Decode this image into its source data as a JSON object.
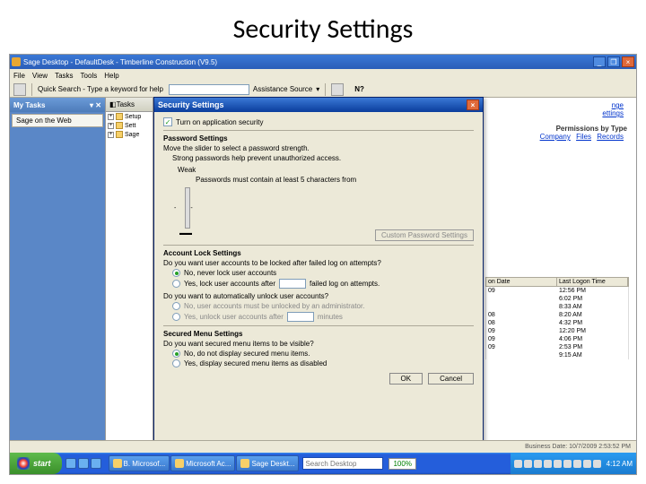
{
  "slide": {
    "title": "Security Settings"
  },
  "app": {
    "title": "Sage Desktop - DefaultDesk - Timberline Construction (V9.5)",
    "menu": [
      "File",
      "View",
      "Tasks",
      "Tools",
      "Help"
    ],
    "quicksearch_label": "Quick Search - Type a keyword for help",
    "assistance_label": "Assistance Source"
  },
  "sidebar": {
    "mytasks_title": "My Tasks",
    "sage_web": "Sage on the Web",
    "tasks_tab": "Tasks",
    "tree": [
      "Setup",
      "Sett",
      "Sage"
    ]
  },
  "rightpanel": {
    "link1": "nge",
    "link2": "ettings",
    "perm_header": "Permissions by Type",
    "perm_links": [
      "Company",
      "Files",
      "Records"
    ],
    "table": {
      "headers": [
        "on Date",
        "Last Logon Time"
      ],
      "rows": [
        [
          "09",
          "12:56 PM"
        ],
        [
          "",
          "6:02 PM"
        ],
        [
          "",
          "8:33 AM"
        ],
        [
          "08",
          "8:20 AM"
        ],
        [
          "08",
          "4:32 PM"
        ],
        [
          "09",
          "12:20 PM"
        ],
        [
          "09",
          "4:06 PM"
        ],
        [
          "09",
          "2:53 PM"
        ],
        [
          "",
          "9:15 AM"
        ]
      ]
    }
  },
  "dialog": {
    "title": "Security Settings",
    "turn_on": "Turn on application security",
    "pw_section": "Password Settings",
    "pw_desc": "Move the slider to select a password strength.",
    "pw_strong": "Strong passwords help prevent unauthorized access.",
    "pw_weak": "Weak",
    "pw_weak_desc": "Passwords must contain at least 5 characters from",
    "custom_btn": "Custom Password Settings",
    "lock_section": "Account Lock Settings",
    "lock_q": "Do you want user accounts to be locked after failed log on attempts?",
    "lock_no": "No, never lock user accounts",
    "lock_yes": "Yes, lock user accounts after",
    "lock_yes_tail": "failed log on attempts.",
    "unlock_q": "Do you want to automatically unlock user accounts?",
    "unlock_no": "No, user accounts must be unlocked by an administrator.",
    "unlock_yes": "Yes, unlock user accounts after",
    "unlock_yes_tail": "minutes",
    "menu_section": "Secured Menu Settings",
    "menu_q": "Do you want secured menu items to be visible?",
    "menu_no": "No, do not display secured menu items.",
    "menu_yes": "Yes, display secured menu items as disabled",
    "ok": "OK",
    "cancel": "Cancel"
  },
  "status": {
    "text": "Business Date: 10/7/2009 2:53:52 PM"
  },
  "taskbar": {
    "start": "start",
    "apps": [
      "B. Microsof...",
      "Microsoft Ac...",
      "Sage Deskt..."
    ],
    "search_placeholder": "Search Desktop",
    "zoom": "100%",
    "clock": "4:12 AM"
  }
}
